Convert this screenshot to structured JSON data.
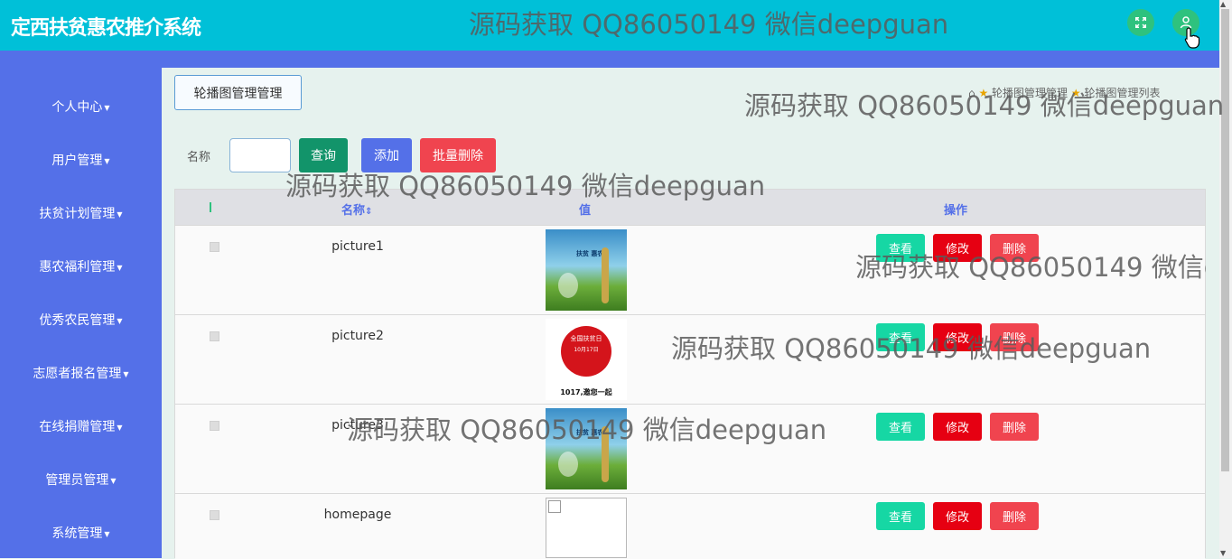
{
  "header": {
    "app_title": "定西扶贫惠农推介系统"
  },
  "sidebar": {
    "items": [
      "个人中心",
      "用户管理",
      "扶贫计划管理",
      "惠农福利管理",
      "优秀农民管理",
      "志愿者报名管理",
      "在线捐赠管理",
      "管理员管理",
      "系统管理"
    ]
  },
  "page": {
    "section_label": "轮播图管理管理",
    "breadcrumb": {
      "level1": "轮播图管理管理",
      "level2": "轮播图管理列表"
    }
  },
  "search": {
    "label": "名称",
    "value": "",
    "query_label": "查询",
    "add_label": "添加",
    "batch_delete_label": "批量删除"
  },
  "table": {
    "headers": {
      "name": "名称",
      "value": "值",
      "actions": "操作"
    },
    "rows": [
      {
        "name": "picture1",
        "image": "harvest-thumbnail"
      },
      {
        "name": "picture2",
        "image": "poverty-day-logo"
      },
      {
        "name": "picture3",
        "image": "harvest-thumbnail"
      },
      {
        "name": "homepage",
        "image": "broken-image"
      }
    ],
    "actions": {
      "view": "查看",
      "edit": "修改",
      "delete": "删除"
    },
    "thumb": {
      "banner_text": "扶贫 惠农",
      "logo_top": "全国扶贫日",
      "logo_date": "10月17日",
      "logo_caption": "1017,邀您一起"
    }
  },
  "watermark": "源码获取 QQ86050149 微信deepguan",
  "colors": {
    "header": "#00c0d8",
    "sidebar": "#5470e8",
    "view": "#16d7a4",
    "edit": "#e60012",
    "delete": "#f0444f",
    "add": "#5470e8",
    "query": "#12946a"
  }
}
